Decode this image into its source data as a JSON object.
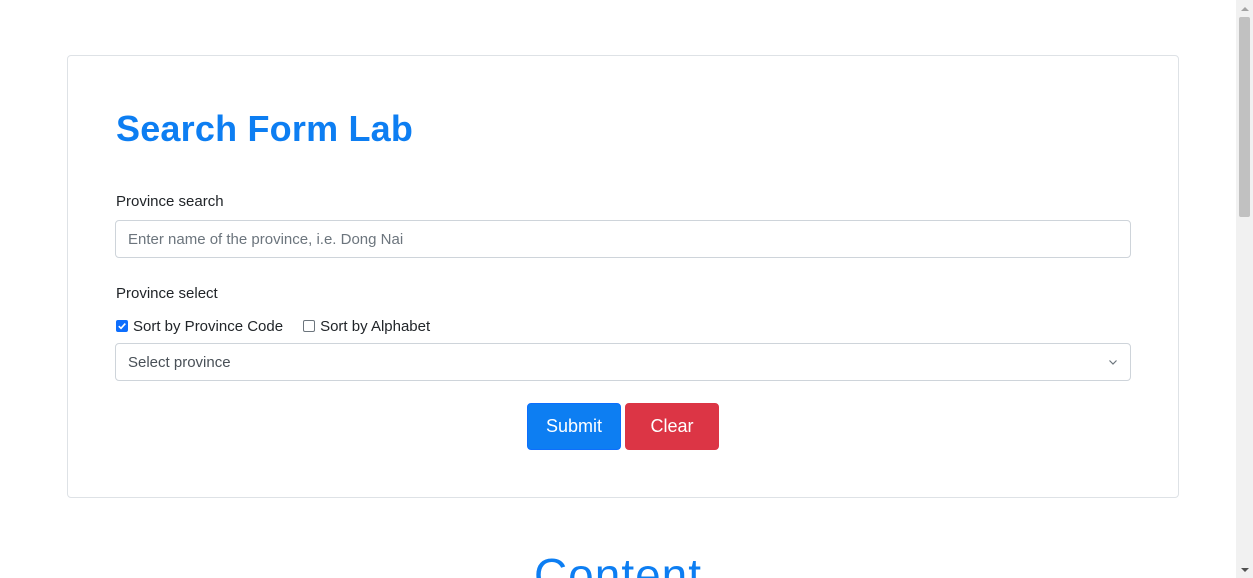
{
  "form": {
    "title": "Search Form Lab",
    "search_label": "Province search",
    "search_placeholder": "Enter name of the province, i.e. Dong Nai",
    "search_value": "",
    "select_label": "Province select",
    "checkboxes": [
      {
        "label": "Sort by Province Code",
        "checked": true
      },
      {
        "label": "Sort by Alphabet",
        "checked": false
      }
    ],
    "select_value": "Select province",
    "submit_label": "Submit",
    "clear_label": "Clear"
  },
  "content": {
    "heading": "Content"
  },
  "colors": {
    "primary": "#0d7ef2",
    "danger": "#dc3545"
  },
  "icons": [
    "checkbox-checked-icon",
    "checkbox-unchecked-icon",
    "chevron-down-icon",
    "scroll-up-arrow-icon",
    "scroll-down-arrow-icon"
  ]
}
